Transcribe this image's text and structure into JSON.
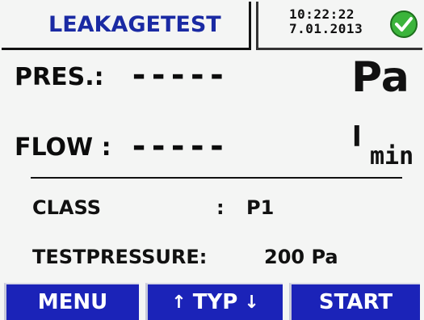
{
  "header": {
    "title": "LEAKAGETEST",
    "time": "10:22:22",
    "date": "7.01.2013",
    "status_icon": "check-icon",
    "status_color": "#3bb43b"
  },
  "readings": {
    "pressure": {
      "label": "PRES.:",
      "value": "-----",
      "unit": "Pa"
    },
    "flow": {
      "label": "FLOW :",
      "value": "-----",
      "unit_l": "l",
      "unit_min": "min"
    }
  },
  "info": {
    "class_label": "CLASS",
    "class_sep": ":",
    "class_value": "P1",
    "testpressure_label": "TESTPRESSURE:",
    "testpressure_value": "200 Pa"
  },
  "buttons": {
    "menu": "MENU",
    "typ": "TYP",
    "typ_up": "↑",
    "typ_down": "↓",
    "start": "START",
    "color": "#1b23b8"
  }
}
